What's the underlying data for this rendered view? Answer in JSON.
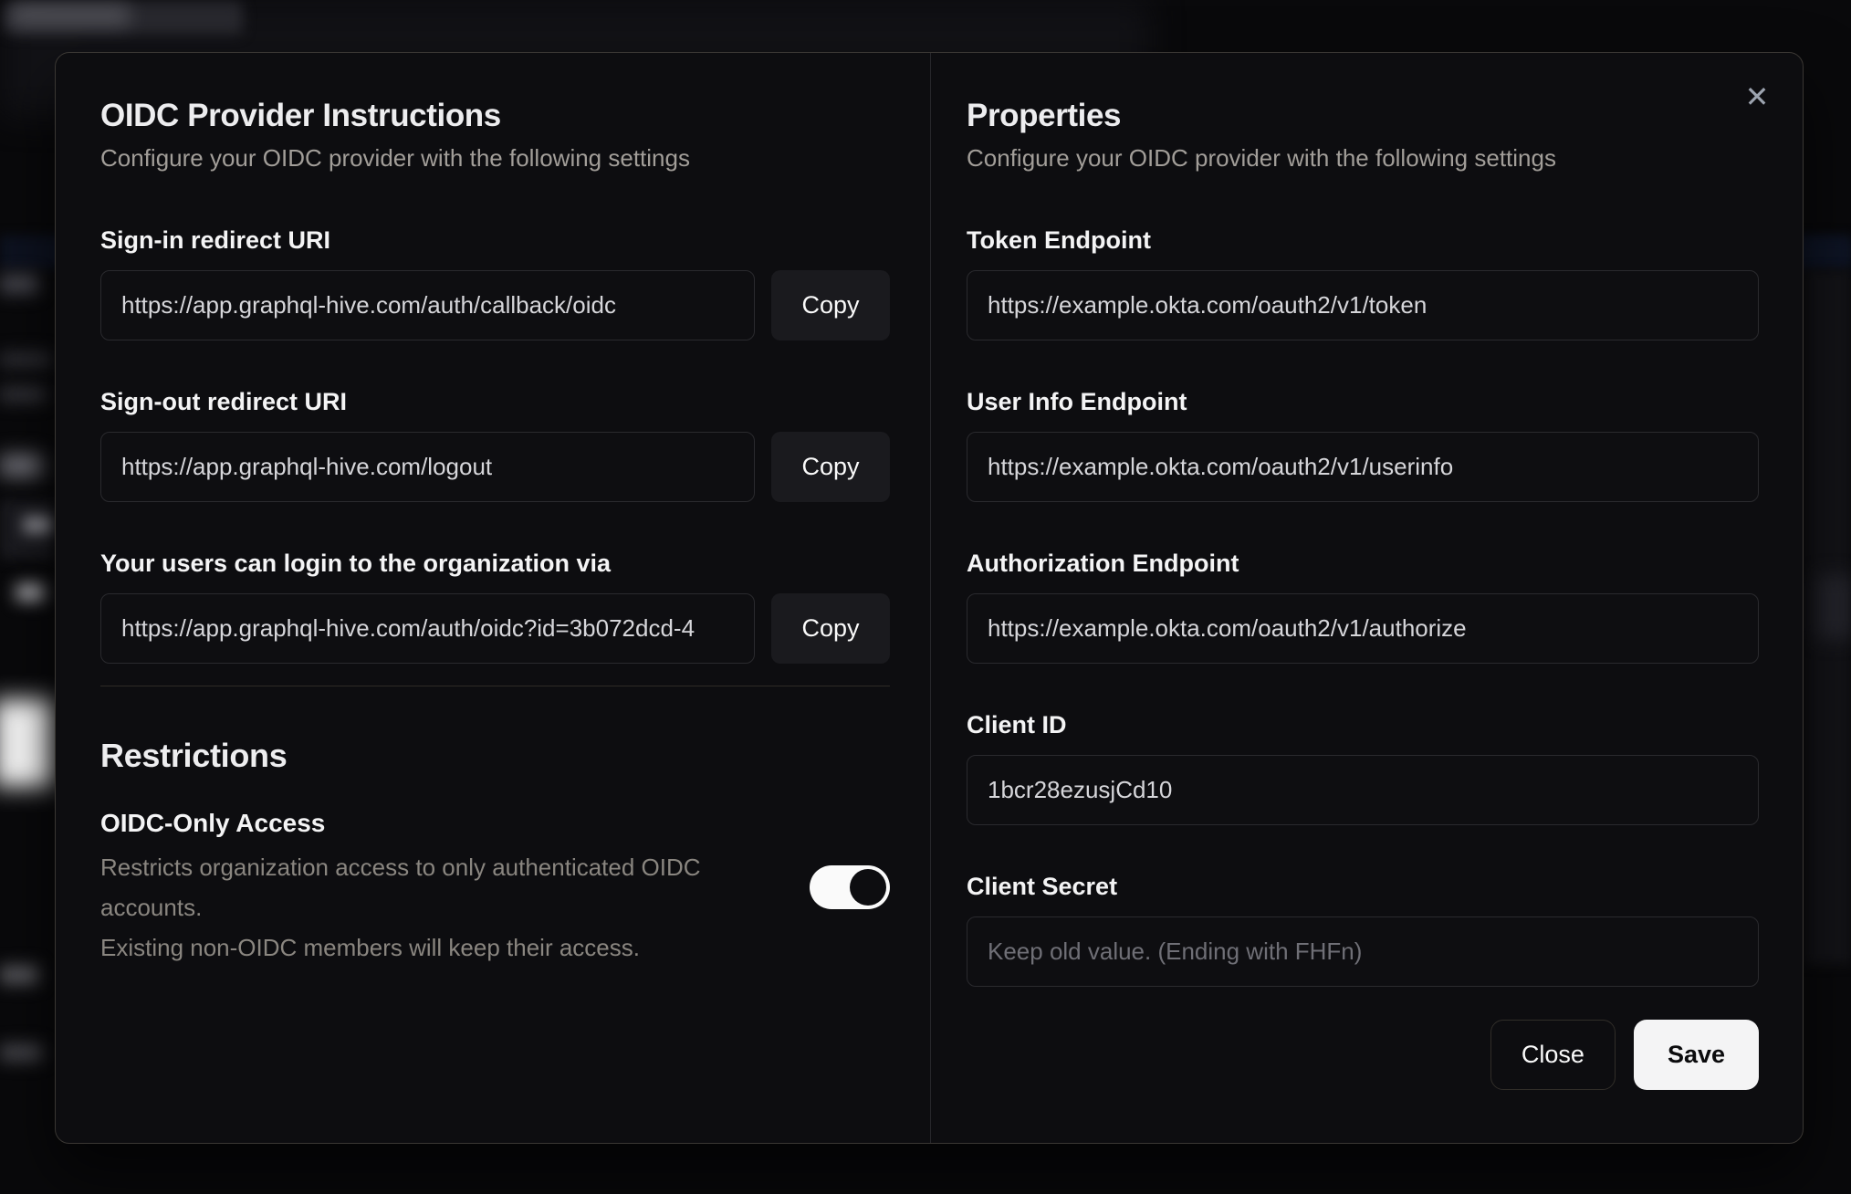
{
  "modal": {
    "close_icon": "✕",
    "left": {
      "title": "OIDC Provider Instructions",
      "subtitle": "Configure your OIDC provider with the following settings",
      "fields": [
        {
          "label": "Sign-in redirect URI",
          "value": "https://app.graphql-hive.com/auth/callback/oidc",
          "button": "Copy"
        },
        {
          "label": "Sign-out redirect URI",
          "value": "https://app.graphql-hive.com/logout",
          "button": "Copy"
        },
        {
          "label": "Your users can login to the organization via",
          "value": "https://app.graphql-hive.com/auth/oidc?id=3b072dcd-4",
          "button": "Copy"
        }
      ],
      "restrictions": {
        "title": "Restrictions",
        "toggle": {
          "label": "OIDC-Only Access",
          "description_line1": "Restricts organization access to only authenticated OIDC accounts.",
          "description_line2": "Existing non-OIDC members will keep their access.",
          "state": "on"
        }
      }
    },
    "right": {
      "title": "Properties",
      "subtitle": "Configure your OIDC provider with the following settings",
      "fields": [
        {
          "label": "Token Endpoint",
          "value": "https://example.okta.com/oauth2/v1/token"
        },
        {
          "label": "User Info Endpoint",
          "value": "https://example.okta.com/oauth2/v1/userinfo"
        },
        {
          "label": "Authorization Endpoint",
          "value": "https://example.okta.com/oauth2/v1/authorize"
        },
        {
          "label": "Client ID",
          "value": "1bcr28ezusjCd10"
        },
        {
          "label": "Client Secret",
          "placeholder": "Keep old value. (Ending with FHFn)"
        }
      ],
      "buttons": {
        "close": "Close",
        "save": "Save"
      }
    }
  },
  "colors": {
    "page_bg": "#09090b",
    "modal_bg": "#0d0d10",
    "accent_button": "#f4f4f5",
    "toggle_on": "#fafafa",
    "muted_text": "#a29e99"
  }
}
